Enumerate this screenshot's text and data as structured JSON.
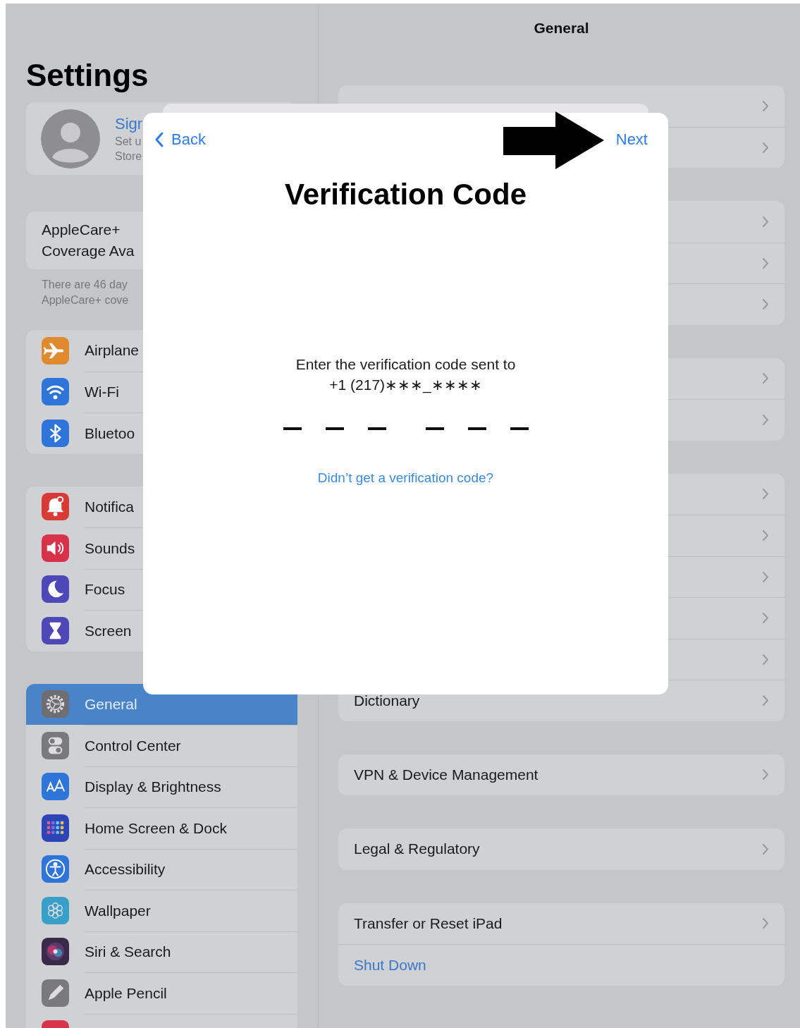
{
  "sidebar": {
    "title": "Settings",
    "profile": {
      "name": "Sigr",
      "lines": [
        "Set u",
        "Store"
      ]
    },
    "applecare": {
      "lines": [
        "AppleCare+",
        "Coverage Ava"
      ],
      "note": [
        "There are 46 day",
        "AppleCare+ cove"
      ]
    },
    "groups": [
      {
        "items": [
          {
            "label": "Airplane",
            "kind": "airplane",
            "color": "#e08a30",
            "selected": false
          },
          {
            "label": "Wi-Fi",
            "kind": "wifi",
            "color": "#2f74d8",
            "selected": false
          },
          {
            "label": "Bluetoo",
            "kind": "bluetooth",
            "color": "#2f74d8",
            "selected": false
          }
        ]
      },
      {
        "items": [
          {
            "label": "Notifica",
            "kind": "bell",
            "color": "#d83a36",
            "selected": false
          },
          {
            "label": "Sounds",
            "kind": "speaker",
            "color": "#d8324a",
            "selected": false
          },
          {
            "label": "Focus",
            "kind": "moon",
            "color": "#4d47b8",
            "selected": false
          },
          {
            "label": "Screen",
            "kind": "hourglass",
            "color": "#4d47b8",
            "selected": false
          }
        ]
      },
      {
        "items": [
          {
            "label": "General",
            "kind": "gear",
            "color": "#6d6d72",
            "selected": true
          },
          {
            "label": "Control Center",
            "kind": "toggles",
            "color": "#7a7a7e",
            "selected": false
          },
          {
            "label": "Display & Brightness",
            "kind": "letters",
            "color": "#2f74d8",
            "selected": false
          },
          {
            "label": "Home Screen & Dock",
            "kind": "grid",
            "color": "#2c44b8",
            "selected": false
          },
          {
            "label": "Accessibility",
            "kind": "person",
            "color": "#2f74d8",
            "selected": false
          },
          {
            "label": "Wallpaper",
            "kind": "flower",
            "color": "#38a0c8",
            "selected": false
          },
          {
            "label": "Siri & Search",
            "kind": "orb",
            "color": "#3a2a4a",
            "selected": false
          },
          {
            "label": "Apple Pencil",
            "kind": "pencil",
            "color": "#7a7a7e",
            "selected": false
          },
          {
            "kind": "blank",
            "color": "#d8334a",
            "selected": false
          }
        ]
      }
    ]
  },
  "detail": {
    "title": "General",
    "groups": [
      {
        "rows": [
          {
            "kind": "nav"
          },
          {
            "kind": "nav"
          }
        ]
      },
      {
        "rows": [
          {
            "kind": "nav"
          },
          {
            "kind": "nav"
          },
          {
            "kind": "nav"
          }
        ]
      },
      {
        "rows": [
          {
            "kind": "nav"
          },
          {
            "kind": "nav"
          }
        ]
      },
      {
        "rows": [
          {
            "kind": "nav"
          },
          {
            "kind": "nav"
          },
          {
            "kind": "nav"
          },
          {
            "kind": "nav"
          },
          {
            "kind": "nav"
          },
          {
            "kind": "nav",
            "label": "Dictionary"
          }
        ]
      },
      {
        "rows": [
          {
            "kind": "nav",
            "label": "VPN & Device Management"
          }
        ]
      },
      {
        "rows": [
          {
            "kind": "nav",
            "label": "Legal & Regulatory"
          }
        ]
      },
      {
        "rows": [
          {
            "kind": "nav",
            "label": "Transfer or Reset iPad"
          },
          {
            "kind": "action",
            "label": "Shut Down"
          }
        ]
      }
    ]
  },
  "dialog": {
    "back": "Back",
    "next": "Next",
    "title": "Verification Code",
    "prompt": "Enter the verification code sent to",
    "phone": "+1 (217)∗∗∗_∗∗∗∗",
    "code_slots": [
      {
        "filled": false
      },
      {
        "filled": false
      },
      {
        "filled": false
      },
      {
        "filled": false
      },
      {
        "filled": false
      },
      {
        "filled": false
      }
    ],
    "help_link": "Didn’t get a verification code?"
  }
}
